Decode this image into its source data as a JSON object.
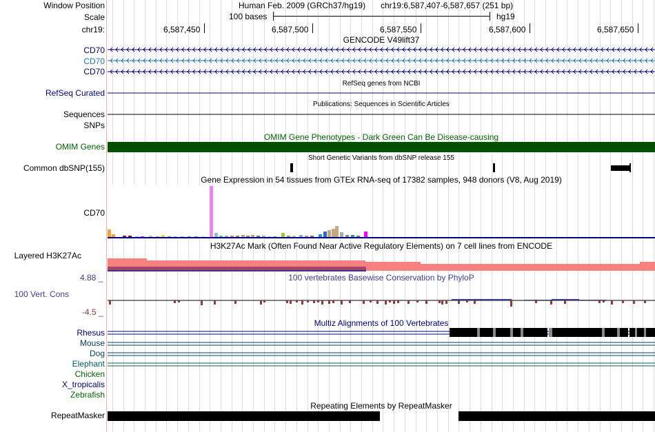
{
  "header": {
    "window_position_label": "Window Position",
    "assembly_text": "Human Feb. 2009 (GRCh37/hg19)",
    "position_text": "chr19:6,587,407-6,587,657 (251 bp)",
    "scale_label": "Scale",
    "scale_bar_text": "100 bases",
    "scale_db": "hg19",
    "chrom_label": "chr19:",
    "ruler_ticks": [
      "6,587,450",
      "6,587,500",
      "6,587,550",
      "6,587,600",
      "6,587,650"
    ]
  },
  "tracks": {
    "gencode_title": "GENCODE V49lift37",
    "gencode_labels": [
      "CD70",
      "CD70",
      "CD70"
    ],
    "refseq_label": "RefSeq Curated",
    "refseq_title": "RefSeq genes from NCBI",
    "sequences_label": "Sequences",
    "publications_title": "Publications: Sequences in Scientific Articles",
    "snps_label": "SNPs",
    "omim_title": "OMIM Gene Phenotypes - Dark Green Can Be Disease-causing",
    "omim_label": "OMIM Genes",
    "dbsnp_title": "Short Genetic Variants from dbSNP release 155",
    "dbsnp_label": "Common dbSNP(155)",
    "gtex_title": "Gene Expression in 54 tissues from GTEx RNA-seq of 17382 samples, 948 donors (V8, Aug 2019)",
    "gtex_label": "CD70",
    "h3k27_title": "H3K27Ac Mark (Often Found Near Active Regulatory Elements) on 7 cell lines from ENCODE",
    "h3k27_label": "Layered H3K27Ac",
    "cons_max": "4.88 _",
    "cons_label": "100 Vert. Cons",
    "cons_min": "-4.5 _",
    "cons_title": "100 vertebrates Basewise Conservation by PhyloP",
    "multiz_title": "Multiz Alignments of 100 Vertebrates",
    "species": [
      "Rhesus",
      "Mouse",
      "Dog",
      "Elephant",
      "Chicken",
      "X_tropicalis",
      "Zebrafish"
    ],
    "rmsk_title": "Repeating Elements by RepeatMasker",
    "rmsk_label": "RepeatMasker"
  },
  "colors": {
    "navy": "#000080",
    "light_blue": "#1e74b5",
    "omim_green": "#005000",
    "h3k27_pink": "#f88080",
    "phylop_positive": "#3c3c8c",
    "phylop_negative": "#8c3c3c",
    "grid": "#dddddd",
    "window_edge": "#ff9999"
  }
}
